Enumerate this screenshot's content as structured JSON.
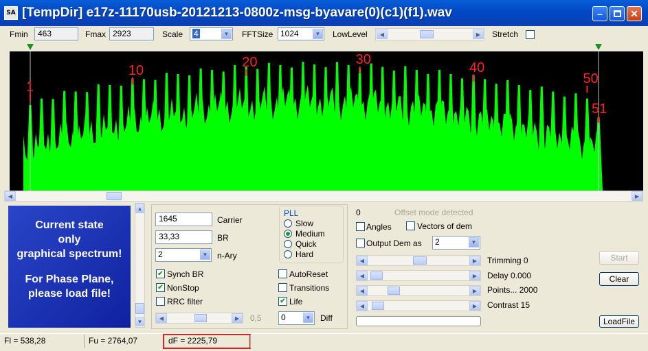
{
  "window": {
    "app_icon": "SA",
    "title": "[TempDir] e17z-11170usb-20121213-0800z-msg-byavare(0)(c1)(f1).wav",
    "minimize_icon": "minimize-icon",
    "maximize_icon": "maximize-icon",
    "close_icon": "close-icon"
  },
  "toolbar": {
    "fmin_label": "Fmin",
    "fmin_value": "463",
    "fmax_label": "Fmax",
    "fmax_value": "2923",
    "scale_label": "Scale",
    "scale_value": "4",
    "fftsize_label": "FFTSize",
    "fftsize_value": "1024",
    "lowlevel_label": "LowLevel",
    "stretch_label": "Stretch"
  },
  "spectrum": {
    "marker_labels": [
      "1",
      "10",
      "20",
      "30",
      "40",
      "50",
      "51"
    ],
    "peak_color": "#00ff00",
    "background_color": "#000000",
    "marker_color": "#ff2020"
  },
  "info_panel": {
    "line1": "Current state",
    "line2": "only",
    "line3": "graphical spectrum!",
    "line4": "For Phase Plane,",
    "line5": "please load file!"
  },
  "demod": {
    "carrier_value": "1645",
    "carrier_label": "Carrier",
    "br_value": "33,33",
    "br_label": "BR",
    "nary_value": "2",
    "nary_label": "n-Ary",
    "pll_title": "PLL",
    "pll_options": [
      "Slow",
      "Medium",
      "Quick",
      "Hard"
    ],
    "synch_br_label": "Synch BR",
    "nonstop_label": "NonStop",
    "rrc_filter_label": "RRC filter",
    "autoreset_label": "AutoReset",
    "transitions_label": "Transitions",
    "life_label": "Life",
    "slider_value": "0,5",
    "diff_value": "0",
    "diff_label": "Diff"
  },
  "right_panel": {
    "offset_value": "0",
    "offset_mode": "Offset mode detected",
    "angles_label": "Angles",
    "vectors_label": "Vectors of dem",
    "output_dem_label": "Output Dem as",
    "output_dem_value": "2",
    "trimming_label": "Trimming 0",
    "delay_label": "Delay  0.000",
    "points_label": "Points... 2000",
    "contrast_label": "Contrast 15",
    "start_button": "Start",
    "clear_button": "Clear",
    "loadfile_button": "LoadFile"
  },
  "status": {
    "fl": "Fl = 538,28",
    "fu": "Fu = 2764,07",
    "df": "dF = 2225,79",
    "highlight_color": "#e02020"
  }
}
